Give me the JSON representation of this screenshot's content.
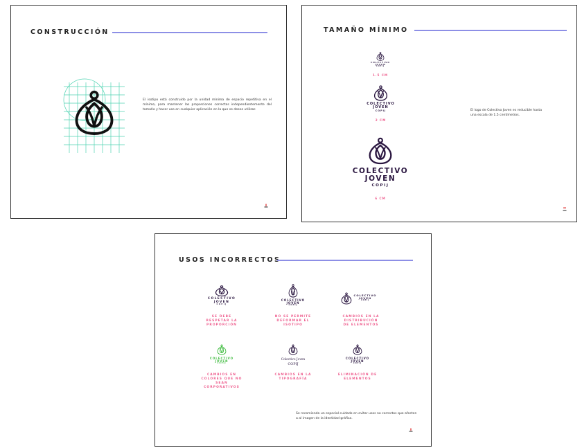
{
  "slides": {
    "construction": {
      "title": "CONSTRUCCIÓN",
      "body": "El isotipo está construido por la unidad mínima de espacio repetitiva en el mínimo, para mantener las proporciones correctas independientemente del tamaño y hacer uso en cualquier aplicación en la que se desee utilizar.",
      "page_number": "2"
    },
    "minimum_size": {
      "title": "TAMAÑO MÍNIMO",
      "body": "El logo de Colectivo Joven es reducible hasta una escala de 1.5 centímetros.",
      "page_number": "3",
      "logo_line1": "COLECTIVO",
      "logo_line2": "JOVEN",
      "logo_line3": "COPIJ",
      "sizes": [
        "1.5 CM",
        "2 CM",
        "6 CM"
      ]
    },
    "incorrect_uses": {
      "title": "USOS INCORRECTOS",
      "body": "Se recomienda un especial cuidado en evitar usos no correctos que afecten a al imagen de la identidad gráfica.",
      "page_number": "4",
      "logo_line1": "COLECTIVO",
      "logo_line2": "JOVEN",
      "logo_line3": "COPIJ",
      "serif_line1": "Colectivo Joven",
      "serif_line2": "COPIJ",
      "captions": [
        "SE DEBE RESPETAR LA PROPORCIÓN",
        "NO SE PERMITE DEFORMAR EL ISOTIPO",
        "CAMBIOS EN LA DISTRIBUCIÓN DE ELEMENTOS",
        "CAMBIOS EN COLORES QUE NO SEAN CORPORATIVOS",
        "CAMBIOS EN LA TIPOGRAFÍA",
        "ELIMINACIÓN DE ELEMENTOS"
      ]
    }
  },
  "colors": {
    "brand_dark": "#2a1640",
    "accent_pink": "#ee5c8d",
    "rule_lavender": "#8d8fe6",
    "grid_teal": "#4fd3b2",
    "wrong_green": "#3dbb3d"
  }
}
